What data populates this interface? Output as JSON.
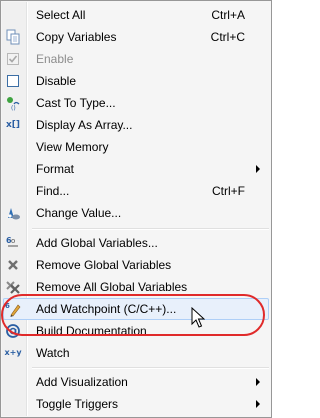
{
  "menu": {
    "items": [
      {
        "label": "Select All",
        "shortcut": "Ctrl+A",
        "icon": "none"
      },
      {
        "label": "Copy Variables",
        "shortcut": "Ctrl+C",
        "icon": "copy-icon"
      },
      {
        "label": "Enable",
        "shortcut": "",
        "icon": "checkbox-checked-icon",
        "disabled": true
      },
      {
        "label": "Disable",
        "shortcut": "",
        "icon": "checkbox-icon"
      },
      {
        "label": "Cast To Type...",
        "shortcut": "",
        "icon": "cast-icon"
      },
      {
        "label": "Display As Array...",
        "shortcut": "",
        "icon": "array-icon"
      },
      {
        "label": "View Memory",
        "shortcut": "",
        "icon": "none"
      },
      {
        "label": "Format",
        "shortcut": "",
        "icon": "none",
        "submenu": true
      },
      {
        "label": "Find...",
        "shortcut": "Ctrl+F",
        "icon": "none"
      },
      {
        "label": "Change Value...",
        "shortcut": "",
        "icon": "change-value-icon"
      },
      {
        "label": "Add Global Variables...",
        "shortcut": "",
        "icon": "global-variables-icon"
      },
      {
        "label": "Remove Global Variables",
        "shortcut": "",
        "icon": "remove-icon"
      },
      {
        "label": "Remove All Global Variables",
        "shortcut": "",
        "icon": "remove-all-icon"
      },
      {
        "label": "Add Watchpoint (C/C++)...",
        "shortcut": "",
        "icon": "watchpoint-icon",
        "highlighted": true
      },
      {
        "label": "Build Documentation",
        "shortcut": "",
        "icon": "documentation-icon"
      },
      {
        "label": "Watch",
        "shortcut": "",
        "icon": "watch-icon"
      },
      {
        "label": "Add Visualization",
        "shortcut": "",
        "icon": "none",
        "submenu": true
      },
      {
        "label": "Toggle Triggers",
        "shortcut": "",
        "icon": "none",
        "submenu": true
      }
    ]
  },
  "icons": {
    "array_text": "x[]",
    "watch_text": "x+y",
    "global_text": "G"
  },
  "colors": {
    "highlight_ring": "#e02a2a",
    "icon_blue": "#2b5fa3",
    "disabled_text": "#8d8d8d"
  }
}
